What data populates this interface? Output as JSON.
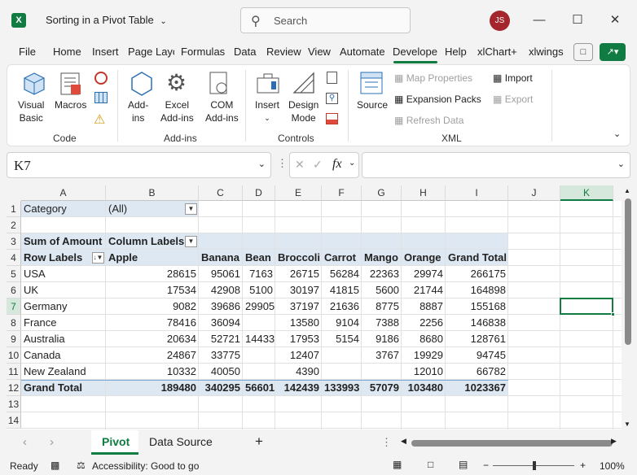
{
  "title_bar": {
    "doc_title": "Sorting in a Pivot Table",
    "search_placeholder": "Search",
    "user_initials": "JS",
    "minimize": "—",
    "maximize": "☐",
    "close": "✕"
  },
  "ribbon_tabs": [
    "File",
    "Home",
    "Insert",
    "Page Layo",
    "Formulas",
    "Data",
    "Review",
    "View",
    "Automate",
    "Develope",
    "Help",
    "xlChart+",
    "xlwings"
  ],
  "ribbon": {
    "code": {
      "group_label": "Code",
      "visual_basic": [
        "Visual",
        "Basic"
      ],
      "macros": "Macros"
    },
    "addins": {
      "group_label": "Add-ins",
      "addins": [
        "Add-",
        "ins"
      ],
      "excel_addins": [
        "Excel",
        "Add-ins"
      ],
      "com_addins": [
        "COM",
        "Add-ins"
      ]
    },
    "controls": {
      "group_label": "Controls",
      "insert": "Insert",
      "design_mode": [
        "Design",
        "Mode"
      ]
    },
    "xml": {
      "group_label": "XML",
      "source": "Source",
      "map_properties": "Map Properties",
      "expansion_packs": "Expansion Packs",
      "refresh_data": "Refresh Data",
      "import": "Import",
      "export": "Export"
    }
  },
  "formula_bar": {
    "name_box": "K7",
    "fx": "fx",
    "formula": ""
  },
  "columns": [
    "A",
    "B",
    "C",
    "D",
    "E",
    "F",
    "G",
    "H",
    "I",
    "J",
    "K"
  ],
  "selected_column": "K",
  "rows": [
    "1",
    "2",
    "3",
    "4",
    "5",
    "6",
    "7",
    "8",
    "9",
    "10",
    "11",
    "12",
    "13",
    "14"
  ],
  "pivot": {
    "filter_label": "Category",
    "filter_value": "(All)",
    "values_label": "Sum of Amount",
    "column_labels": "Column Labels",
    "row_labels": "Row Labels",
    "headers": [
      "Apple",
      "Banana",
      "Bean",
      "Broccoli",
      "Carrot",
      "Mango",
      "Orange",
      "Grand Total"
    ],
    "data": [
      {
        "label": "USA",
        "values": [
          "28615",
          "95061",
          "7163",
          "26715",
          "56284",
          "22363",
          "29974",
          "266175"
        ]
      },
      {
        "label": "UK",
        "values": [
          "17534",
          "42908",
          "5100",
          "30197",
          "41815",
          "5600",
          "21744",
          "164898"
        ]
      },
      {
        "label": "Germany",
        "values": [
          "9082",
          "39686",
          "29905",
          "37197",
          "21636",
          "8775",
          "8887",
          "155168"
        ]
      },
      {
        "label": "France",
        "values": [
          "78416",
          "36094",
          "",
          "13580",
          "9104",
          "7388",
          "2256",
          "146838"
        ]
      },
      {
        "label": "Australia",
        "values": [
          "20634",
          "52721",
          "14433",
          "17953",
          "5154",
          "9186",
          "8680",
          "128761"
        ]
      },
      {
        "label": "Canada",
        "values": [
          "24867",
          "33775",
          "",
          "12407",
          "",
          "3767",
          "19929",
          "94745"
        ]
      },
      {
        "label": "New Zealand",
        "values": [
          "10332",
          "40050",
          "",
          "4390",
          "",
          "",
          "12010",
          "66782"
        ]
      }
    ],
    "grand_total": {
      "label": "Grand Total",
      "values": [
        "189480",
        "340295",
        "56601",
        "142439",
        "133993",
        "57079",
        "103480",
        "1023367"
      ]
    }
  },
  "sheets": {
    "active": "Pivot",
    "other": "Data Source",
    "add": "+"
  },
  "status_bar": {
    "ready": "Ready",
    "accessibility": "Accessibility: Good to go",
    "zoom": "100%",
    "zoom_minus": "−",
    "zoom_plus": "+"
  }
}
